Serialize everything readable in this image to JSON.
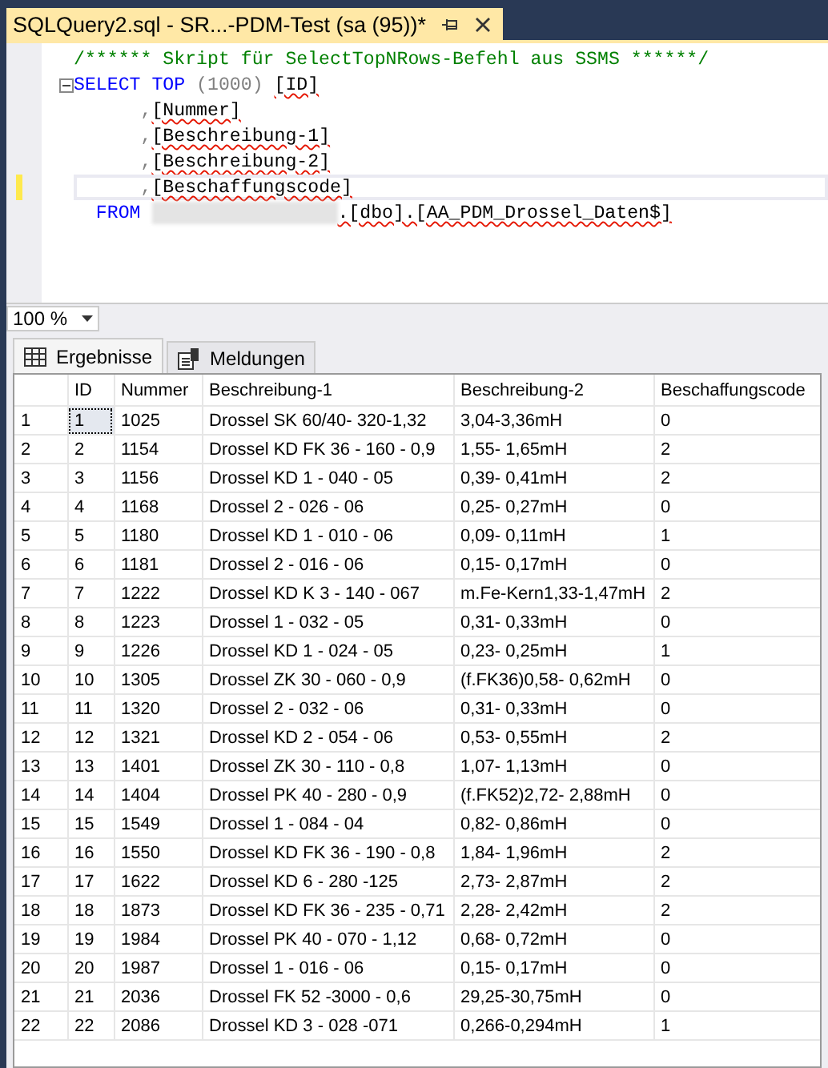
{
  "document_tab": {
    "title": "SQLQuery2.sql - SR...-PDM-Test (sa (95))*",
    "selected": true
  },
  "editor": {
    "lines": [
      {
        "current": false,
        "collapsible": false,
        "segments": [
          {
            "kind": "comment",
            "text": "/****** Skript für SelectTopNRows-Befehl aus SSMS ******/"
          }
        ]
      },
      {
        "current": false,
        "collapsible": true,
        "segments": [
          {
            "kind": "keyword",
            "text": "SELECT TOP "
          },
          {
            "kind": "punct",
            "text": "(1000) "
          },
          {
            "kind": "ident",
            "text": "[ID]"
          }
        ]
      },
      {
        "current": false,
        "collapsible": false,
        "segments": [
          {
            "kind": "indent"
          },
          {
            "kind": "punct",
            "text": ","
          },
          {
            "kind": "ident",
            "text": "[Nummer]"
          }
        ]
      },
      {
        "current": false,
        "collapsible": false,
        "segments": [
          {
            "kind": "indent"
          },
          {
            "kind": "punct",
            "text": ","
          },
          {
            "kind": "ident",
            "text": "[Beschreibung-1]"
          }
        ]
      },
      {
        "current": false,
        "collapsible": false,
        "segments": [
          {
            "kind": "indent"
          },
          {
            "kind": "punct",
            "text": ","
          },
          {
            "kind": "ident",
            "text": "[Beschreibung-2]"
          }
        ]
      },
      {
        "current": true,
        "collapsible": false,
        "segments": [
          {
            "kind": "indent"
          },
          {
            "kind": "punct",
            "text": ","
          },
          {
            "kind": "ident",
            "text": "[Beschaffungscode]"
          }
        ]
      },
      {
        "current": false,
        "collapsible": false,
        "segments": [
          {
            "kind": "keyword",
            "text": "  FROM "
          },
          {
            "kind": "redacted"
          },
          {
            "kind": "ident",
            "text": ".[dbo].[AA_PDM_Drossel_Daten$]"
          }
        ]
      }
    ]
  },
  "zoom": {
    "value": "100 %"
  },
  "result_tabs": [
    {
      "label": "Ergebnisse",
      "kind": "grid",
      "selected": true
    },
    {
      "label": "Meldungen",
      "kind": "messages",
      "selected": false
    }
  ],
  "table": {
    "columns": [
      "ID",
      "Nummer",
      "Beschreibung-1",
      "Beschreibung-2",
      "Beschaffungscode"
    ],
    "rows": [
      {
        "row": "1",
        "focused": true,
        "cells": [
          "1",
          "1025",
          "Drossel SK 60/40- 320-1,32",
          "3,04-3,36mH",
          "0"
        ]
      },
      {
        "row": "2",
        "focused": false,
        "cells": [
          "2",
          "1154",
          "Drossel KD FK 36 - 160 - 0,9",
          "1,55- 1,65mH",
          "2"
        ]
      },
      {
        "row": "3",
        "focused": false,
        "cells": [
          "3",
          "1156",
          "Drossel KD 1 - 040 - 05",
          "0,39- 0,41mH",
          "2"
        ]
      },
      {
        "row": "4",
        "focused": false,
        "cells": [
          "4",
          "1168",
          "Drossel 2 - 026 - 06",
          "0,25- 0,27mH",
          "0"
        ]
      },
      {
        "row": "5",
        "focused": false,
        "cells": [
          "5",
          "1180",
          "Drossel KD 1 - 010 - 06",
          "0,09- 0,11mH",
          "1"
        ]
      },
      {
        "row": "6",
        "focused": false,
        "cells": [
          "6",
          "1181",
          "Drossel 2 - 016 - 06",
          "0,15- 0,17mH",
          "0"
        ]
      },
      {
        "row": "7",
        "focused": false,
        "cells": [
          "7",
          "1222",
          "Drossel KD K 3 - 140 - 067",
          "m.Fe-Kern1,33-1,47mH",
          "2"
        ]
      },
      {
        "row": "8",
        "focused": false,
        "cells": [
          "8",
          "1223",
          "Drossel 1 - 032 - 05",
          "0,31- 0,33mH",
          "0"
        ]
      },
      {
        "row": "9",
        "focused": false,
        "cells": [
          "9",
          "1226",
          "Drossel KD 1 - 024 - 05",
          "0,23- 0,25mH",
          "1"
        ]
      },
      {
        "row": "10",
        "focused": false,
        "cells": [
          "10",
          "1305",
          "Drossel ZK 30 - 060 - 0,9",
          "(f.FK36)0,58- 0,62mH",
          "0"
        ]
      },
      {
        "row": "11",
        "focused": false,
        "cells": [
          "11",
          "1320",
          "Drossel 2 - 032 - 06",
          "0,31- 0,33mH",
          "0"
        ]
      },
      {
        "row": "12",
        "focused": false,
        "cells": [
          "12",
          "1321",
          "Drossel KD 2 - 054 - 06",
          "0,53- 0,55mH",
          "2"
        ]
      },
      {
        "row": "13",
        "focused": false,
        "cells": [
          "13",
          "1401",
          "Drossel ZK 30 - 110 - 0,8",
          "1,07- 1,13mH",
          "0"
        ]
      },
      {
        "row": "14",
        "focused": false,
        "cells": [
          "14",
          "1404",
          "Drossel PK 40 - 280 - 0,9",
          "(f.FK52)2,72- 2,88mH",
          "0"
        ]
      },
      {
        "row": "15",
        "focused": false,
        "cells": [
          "15",
          "1549",
          "Drossel 1 - 084 - 04",
          "0,82- 0,86mH",
          "0"
        ]
      },
      {
        "row": "16",
        "focused": false,
        "cells": [
          "16",
          "1550",
          "Drossel KD FK 36 - 190 - 0,8",
          "1,84- 1,96mH",
          "2"
        ]
      },
      {
        "row": "17",
        "focused": false,
        "cells": [
          "17",
          "1622",
          "Drossel KD 6 - 280 -125",
          "2,73- 2,87mH",
          "2"
        ]
      },
      {
        "row": "18",
        "focused": false,
        "cells": [
          "18",
          "1873",
          "Drossel KD FK 36 - 235 - 0,71",
          "2,28- 2,42mH",
          "2"
        ]
      },
      {
        "row": "19",
        "focused": false,
        "cells": [
          "19",
          "1984",
          "Drossel PK 40 - 070 - 1,12",
          "0,68- 0,72mH",
          "0"
        ]
      },
      {
        "row": "20",
        "focused": false,
        "cells": [
          "20",
          "1987",
          "Drossel 1 - 016 - 06",
          "0,15- 0,17mH",
          "0"
        ]
      },
      {
        "row": "21",
        "focused": false,
        "cells": [
          "21",
          "2036",
          "Drossel FK 52 -3000 - 0,6",
          "29,25-30,75mH",
          "0"
        ]
      },
      {
        "row": "22",
        "focused": false,
        "cells": [
          "22",
          "2086",
          "Drossel KD 3 - 028 -071",
          "0,266-0,294mH",
          "1"
        ]
      }
    ]
  }
}
